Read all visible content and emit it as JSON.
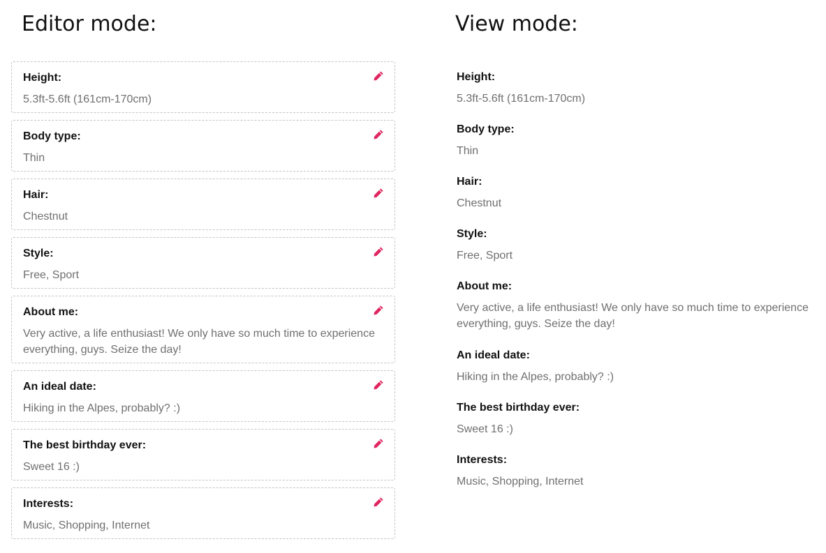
{
  "editor": {
    "heading": "Editor mode:",
    "fields": [
      {
        "label": "Height:",
        "value": "5.3ft-5.6ft (161cm-170cm)"
      },
      {
        "label": "Body type:",
        "value": "Thin"
      },
      {
        "label": "Hair:",
        "value": "Chestnut"
      },
      {
        "label": "Style:",
        "value": "Free, Sport"
      },
      {
        "label": "About me:",
        "value": "Very active, a life enthusiast! We only have so much time to experience everything, guys. Seize the day!"
      },
      {
        "label": "An ideal date:",
        "value": "Hiking in the Alpes, probably? :)"
      },
      {
        "label": "The best birthday ever:",
        "value": "Sweet 16 :)"
      },
      {
        "label": "Interests:",
        "value": "Music, Shopping, Internet"
      }
    ],
    "edit_icon": "pencil-icon",
    "accent_color": "#e0245e"
  },
  "view": {
    "heading": "View mode:",
    "fields": [
      {
        "label": "Height:",
        "value": "5.3ft-5.6ft (161cm-170cm)"
      },
      {
        "label": "Body type:",
        "value": "Thin"
      },
      {
        "label": "Hair:",
        "value": "Chestnut"
      },
      {
        "label": "Style:",
        "value": "Free, Sport"
      },
      {
        "label": "About me:",
        "value": "Very active, a life enthusiast! We only have so much time to experience everything, guys. Seize the day!"
      },
      {
        "label": "An ideal date:",
        "value": "Hiking in the Alpes, probably? :)"
      },
      {
        "label": "The best birthday ever:",
        "value": "Sweet 16 :)"
      },
      {
        "label": "Interests:",
        "value": "Music, Shopping, Internet"
      }
    ]
  }
}
